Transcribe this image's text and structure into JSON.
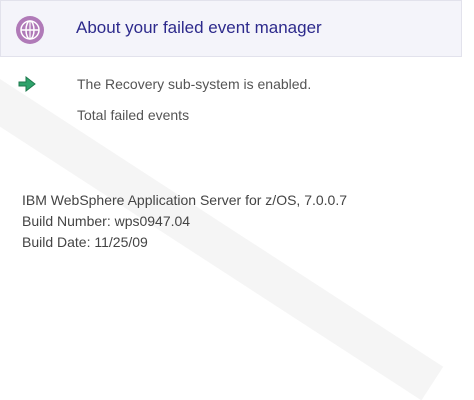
{
  "header": {
    "title": "About your failed event manager",
    "icon": "globe-icon"
  },
  "status": {
    "icon": "check-arrow-icon",
    "text": "The Recovery sub-system is enabled."
  },
  "total_label": "Total failed events",
  "footer": {
    "product": "IBM WebSphere Application Server for z/OS, 7.0.0.7",
    "build_number": "Build Number: wps0947.04",
    "build_date": "Build Date: 11/25/09"
  },
  "colors": {
    "title": "#2d2a8c",
    "globe": "#a96cb3",
    "status_icon": "#2fa36b"
  }
}
